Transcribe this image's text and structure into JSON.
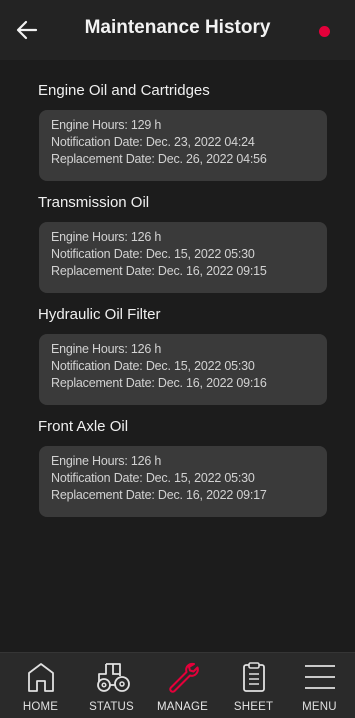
{
  "header": {
    "title": "Maintenance History",
    "back_icon": "arrow-left-icon",
    "notification_color": "#e4003a"
  },
  "records": [
    {
      "name": "Engine Oil and Cartridges",
      "engine_hours": "Engine Hours: 129 h",
      "notification_date": "Notification Date: Dec. 23, 2022 04:24",
      "replacement_date": "Replacement Date: Dec. 26, 2022 04:56"
    },
    {
      "name": "Transmission Oil",
      "engine_hours": "Engine Hours: 126 h",
      "notification_date": "Notification Date: Dec. 15, 2022 05:30",
      "replacement_date": "Replacement Date: Dec. 16, 2022 09:15"
    },
    {
      "name": "Hydraulic Oil Filter",
      "engine_hours": "Engine Hours: 126 h",
      "notification_date": "Notification Date: Dec. 15, 2022 05:30",
      "replacement_date": "Replacement Date: Dec. 16, 2022 09:16"
    },
    {
      "name": "Front Axle Oil",
      "engine_hours": "Engine Hours: 126 h",
      "notification_date": "Notification Date: Dec. 15, 2022 05:30",
      "replacement_date": "Replacement Date: Dec. 16, 2022 09:17"
    }
  ],
  "nav": {
    "active_color": "#e4003a",
    "items": [
      {
        "label": "HOME",
        "icon": "home-icon"
      },
      {
        "label": "STATUS",
        "icon": "tractor-icon"
      },
      {
        "label": "MANAGE",
        "icon": "wrench-icon",
        "active": true
      },
      {
        "label": "SHEET",
        "icon": "clipboard-icon"
      },
      {
        "label": "MENU",
        "icon": "hamburger-menu-icon"
      }
    ]
  }
}
